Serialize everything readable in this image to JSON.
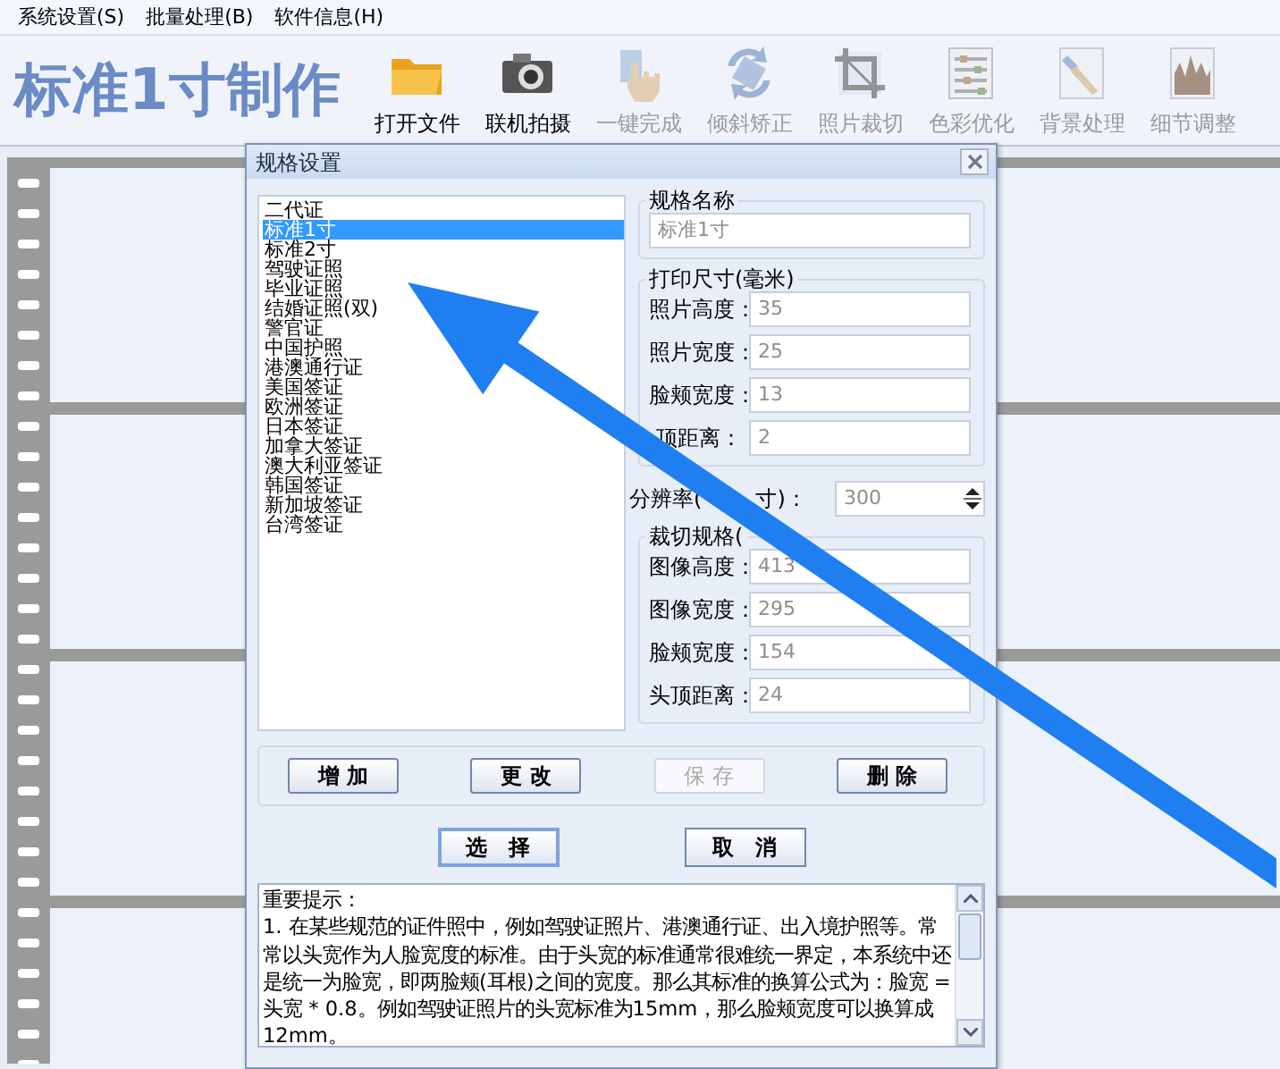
{
  "menu": [
    {
      "label": "系统设置(S)"
    },
    {
      "label": "批量处理(B)"
    },
    {
      "label": "软件信息(H)"
    }
  ],
  "app_title": "标准1寸制作",
  "toolbar": [
    {
      "kind": "folder",
      "label": "打开文件",
      "disabled": false
    },
    {
      "kind": "camera",
      "label": "联机拍摄",
      "disabled": false
    },
    {
      "kind": "hand",
      "label": "一键完成",
      "disabled": true
    },
    {
      "kind": "rotate",
      "label": "倾斜矫正",
      "disabled": true
    },
    {
      "kind": "crop",
      "label": "照片裁切",
      "disabled": true
    },
    {
      "kind": "sliders",
      "label": "色彩优化",
      "disabled": true
    },
    {
      "kind": "brush",
      "label": "背景处理",
      "disabled": true
    },
    {
      "kind": "histogram",
      "label": "细节调整",
      "disabled": true
    }
  ],
  "dialog": {
    "title": "规格设置",
    "spec_list": [
      {
        "label": "二代证",
        "selected": false
      },
      {
        "label": "标准1寸",
        "selected": true
      },
      {
        "label": "标准2寸",
        "selected": false
      },
      {
        "label": "驾驶证照",
        "selected": false
      },
      {
        "label": "毕业证照",
        "selected": false
      },
      {
        "label": "结婚证照(双)",
        "selected": false
      },
      {
        "label": "警官证",
        "selected": false
      },
      {
        "label": "中国护照",
        "selected": false
      },
      {
        "label": "港澳通行证",
        "selected": false
      },
      {
        "label": "美国签证",
        "selected": false
      },
      {
        "label": "欧洲签证",
        "selected": false
      },
      {
        "label": "日本签证",
        "selected": false
      },
      {
        "label": "加拿大签证",
        "selected": false
      },
      {
        "label": "澳大利亚签证",
        "selected": false
      },
      {
        "label": "韩国签证",
        "selected": false
      },
      {
        "label": "新加坡签证",
        "selected": false
      },
      {
        "label": "台湾签证",
        "selected": false
      }
    ],
    "spec_name": {
      "legend": "规格名称",
      "value": "标准1寸"
    },
    "print_size": {
      "legend": "打印尺寸(毫米)",
      "fields": [
        {
          "label": "照片高度：",
          "value": "35"
        },
        {
          "label": "照片宽度：",
          "value": "25"
        },
        {
          "label": "脸颊宽度：",
          "value": "13"
        },
        {
          "label": "顶距离：",
          "value": "2"
        }
      ]
    },
    "resolution": {
      "label_start": "分辨率(",
      "label_end": "寸)：",
      "value": "300"
    },
    "crop_size": {
      "legend": "裁切规格(",
      "fields": [
        {
          "label": "图像高度：",
          "value": "413"
        },
        {
          "label": "图像宽度：",
          "value": "295"
        },
        {
          "label": "脸颊宽度：",
          "value": "154"
        },
        {
          "label": "头顶距离：",
          "value": "24"
        }
      ]
    },
    "edit_buttons": [
      {
        "label": "增 加",
        "disabled": false
      },
      {
        "label": "更 改",
        "disabled": false
      },
      {
        "label": "保 存",
        "disabled": true
      },
      {
        "label": "删 除",
        "disabled": false
      }
    ],
    "action_buttons": [
      {
        "label": "选　择"
      },
      {
        "label": "取　消"
      }
    ],
    "notes": "重要提示：\n1. 在某些规范的证件照中，例如驾驶证照片、港澳通行证、出入境护照等。常常以头宽作为人脸宽度的标准。由于头宽的标准通常很难统一界定，本系统中还是统一为脸宽，即两脸颊(耳根)之间的宽度。那么其标准的换算公式为：脸宽 = 头宽 * 0.8。例如驾驶证照片的头宽标准为15mm，那么脸颊宽度可以换算成12mm。"
  }
}
